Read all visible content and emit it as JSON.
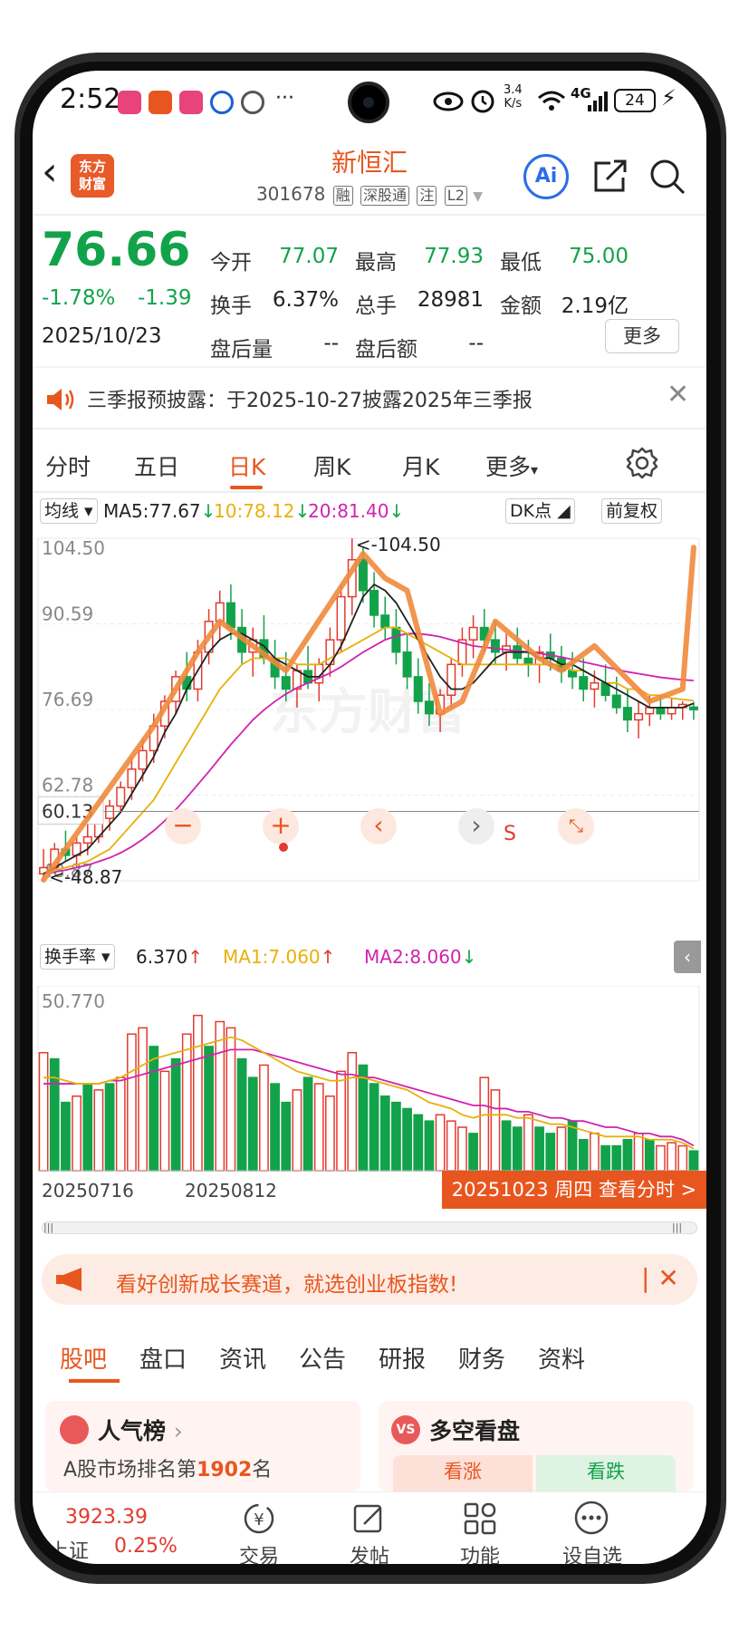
{
  "status_bar": {
    "time": "2:52",
    "dots": "···",
    "net_speed_top": "3.4",
    "net_speed_bottom": "K/s",
    "signal": "4G",
    "battery": "24"
  },
  "header": {
    "logo_line1": "东方",
    "logo_line2": "财富",
    "title": "新恒汇",
    "code": "301678",
    "tags": [
      "融",
      "深股通",
      "注",
      "L2"
    ],
    "ai_label": "Ai"
  },
  "quote": {
    "price": "76.66",
    "change_pct": "-1.78%",
    "change": "-1.39",
    "date": "2025/10/23",
    "rows": [
      [
        {
          "label": "今开",
          "value": "77.07",
          "color": "#12a34a"
        },
        {
          "label": "最高",
          "value": "77.93",
          "color": "#12a34a"
        },
        {
          "label": "最低",
          "value": "75.00",
          "color": "#12a34a"
        }
      ],
      [
        {
          "label": "换手",
          "value": "6.37%",
          "color": "#222222"
        },
        {
          "label": "总手",
          "value": "28981",
          "color": "#222222"
        },
        {
          "label": "金额",
          "value": "2.19亿",
          "color": "#222222"
        }
      ],
      [
        {
          "label": "盘后量",
          "value": "--",
          "color": "#222222"
        },
        {
          "label": "盘后额",
          "value": "--",
          "color": "#222222"
        }
      ]
    ],
    "more_label": "更多"
  },
  "notice": {
    "text": "三季报预披露：于2025-10-27披露2025年三季报"
  },
  "kline_tabs": {
    "items": [
      "分时",
      "五日",
      "日K",
      "周K",
      "月K",
      "更多"
    ],
    "active": 2,
    "more_caret": "▾"
  },
  "ma_row": {
    "selector": "均线",
    "ma5": "MA5:77.67",
    "ma10": "10:78.12",
    "ma20": "20:81.40",
    "dk": "DK点",
    "adjust": "前复权",
    "colors": {
      "ma5": "#222222",
      "ma10": "#e8b00a",
      "ma20": "#d023b0",
      "down": "#12a34a",
      "up": "#e23b2e"
    }
  },
  "chart_data": [
    {
      "type": "candlestick",
      "y_ticks": [
        "104.50",
        "90.59",
        "76.69",
        "62.78",
        "48.87"
      ],
      "ylim": [
        48.87,
        104.5
      ],
      "current_price_label": "60.13",
      "current_price": 60.13,
      "max_label": "<-104.50",
      "min_label": "<-48.87",
      "ohlc": [
        [
          50,
          54,
          49,
          51
        ],
        [
          51,
          55,
          50,
          54
        ],
        [
          54,
          57,
          52,
          53
        ],
        [
          53,
          56,
          51,
          55
        ],
        [
          55,
          58,
          53,
          56
        ],
        [
          56,
          60,
          55,
          59
        ],
        [
          59,
          62,
          57,
          61
        ],
        [
          61,
          65,
          60,
          64
        ],
        [
          64,
          69,
          62,
          67
        ],
        [
          67,
          72,
          65,
          70
        ],
        [
          70,
          76,
          68,
          74
        ],
        [
          74,
          79,
          72,
          78
        ],
        [
          78,
          83,
          76,
          82
        ],
        [
          82,
          86,
          78,
          80
        ],
        [
          80,
          88,
          78,
          86
        ],
        [
          86,
          93,
          84,
          91
        ],
        [
          91,
          96,
          88,
          94
        ],
        [
          94,
          97,
          88,
          90
        ],
        [
          90,
          93,
          84,
          86
        ],
        [
          86,
          90,
          82,
          88
        ],
        [
          88,
          92,
          84,
          85
        ],
        [
          85,
          88,
          80,
          82
        ],
        [
          82,
          86,
          78,
          80
        ],
        [
          80,
          84,
          77,
          83
        ],
        [
          83,
          87,
          80,
          81
        ],
        [
          81,
          85,
          78,
          84
        ],
        [
          84,
          90,
          82,
          88
        ],
        [
          88,
          97,
          86,
          95
        ],
        [
          95,
          104.5,
          92,
          101
        ],
        [
          101,
          103,
          94,
          96
        ],
        [
          96,
          99,
          90,
          92
        ],
        [
          92,
          95,
          88,
          90
        ],
        [
          90,
          93,
          84,
          86
        ],
        [
          86,
          89,
          80,
          82
        ],
        [
          82,
          85,
          76,
          78
        ],
        [
          78,
          81,
          74,
          76
        ],
        [
          76,
          80,
          73,
          79
        ],
        [
          79,
          85,
          77,
          84
        ],
        [
          84,
          90,
          82,
          88
        ],
        [
          88,
          92,
          85,
          90
        ],
        [
          90,
          93,
          86,
          88
        ],
        [
          88,
          91,
          84,
          86
        ],
        [
          86,
          89,
          83,
          87
        ],
        [
          87,
          90,
          84,
          85
        ],
        [
          85,
          88,
          82,
          84
        ],
        [
          84,
          87,
          81,
          86
        ],
        [
          86,
          89,
          83,
          85
        ],
        [
          85,
          87,
          81,
          83
        ],
        [
          83,
          86,
          80,
          82
        ],
        [
          82,
          85,
          78,
          80
        ],
        [
          80,
          83,
          77,
          81
        ],
        [
          81,
          84,
          78,
          79
        ],
        [
          79,
          82,
          76,
          77
        ],
        [
          77,
          80,
          73,
          75
        ],
        [
          75,
          78,
          72,
          76
        ],
        [
          76,
          79,
          74,
          77
        ],
        [
          77,
          79,
          75,
          76
        ],
        [
          76,
          78.5,
          75,
          77
        ],
        [
          77,
          78,
          75,
          77.5
        ],
        [
          77.07,
          77.93,
          75,
          76.66
        ]
      ],
      "ma5": [
        50,
        51,
        52,
        53,
        54,
        56,
        58,
        60,
        63,
        66,
        69,
        73,
        76,
        80,
        83,
        86,
        88,
        89,
        89,
        88,
        87,
        85,
        84,
        83,
        82,
        82,
        84,
        87,
        91,
        95,
        97,
        96,
        94,
        91,
        88,
        85,
        82,
        80,
        80,
        81,
        83,
        85,
        86,
        86,
        86,
        85,
        85,
        84,
        84,
        83,
        82,
        81,
        80,
        79,
        78,
        77,
        77,
        77,
        77,
        77.67
      ],
      "ma10": [
        50,
        50.5,
        51,
        51.5,
        52,
        53,
        54,
        56,
        58,
        60,
        62,
        65,
        68,
        71,
        74,
        77,
        80,
        82,
        84,
        85,
        85,
        85,
        85,
        84,
        84,
        84,
        85,
        86,
        87,
        88,
        89,
        90,
        90,
        89,
        88,
        87,
        86,
        85,
        84,
        84,
        84,
        84,
        84,
        84,
        84,
        84,
        84,
        84,
        83,
        83,
        82,
        81,
        81,
        80,
        80,
        79,
        79,
        78.5,
        78.3,
        78.12
      ],
      "ma20": [
        50,
        50.3,
        50.6,
        51,
        51.4,
        52,
        52.6,
        53.4,
        54.4,
        55.6,
        57,
        58.6,
        60.4,
        62.4,
        64.5,
        66.6,
        68.8,
        71,
        73,
        75,
        76.6,
        78,
        79.2,
        80.2,
        81,
        81.8,
        82.6,
        83.6,
        84.8,
        86,
        87,
        88,
        88.6,
        89,
        89,
        88.8,
        88.5,
        88,
        87.5,
        87,
        86.8,
        86.6,
        86.4,
        86.2,
        86,
        85.8,
        85.5,
        85.2,
        84.8,
        84.4,
        84,
        83.6,
        83.2,
        82.8,
        82.5,
        82.2,
        81.9,
        81.7,
        81.5,
        81.4
      ]
    },
    {
      "type": "bar",
      "title": "换手率",
      "values_label": "6.370",
      "ma1_label": "MA1:7.060",
      "ma2_label": "MA2:8.060",
      "y_top_label": "50.770",
      "ylim": [
        0,
        50.77
      ],
      "values": [
        38,
        36,
        22,
        24,
        28,
        26,
        28,
        30,
        44,
        46,
        40,
        32,
        36,
        44,
        50,
        40,
        48,
        46,
        36,
        30,
        34,
        28,
        22,
        26,
        30,
        28,
        24,
        32,
        38,
        34,
        28,
        24,
        22,
        20,
        18,
        16,
        18,
        16,
        14,
        12,
        30,
        26,
        16,
        14,
        18,
        14,
        12,
        14,
        16,
        10,
        12,
        8,
        8,
        10,
        12,
        10,
        8,
        9,
        8,
        6.37
      ],
      "up": [
        1,
        0,
        0,
        1,
        0,
        1,
        0,
        1,
        1,
        1,
        0,
        1,
        0,
        1,
        1,
        0,
        1,
        1,
        0,
        0,
        1,
        0,
        0,
        1,
        0,
        1,
        1,
        1,
        1,
        0,
        0,
        0,
        0,
        0,
        0,
        0,
        1,
        1,
        1,
        0,
        1,
        1,
        0,
        0,
        1,
        0,
        0,
        1,
        0,
        0,
        1,
        0,
        0,
        0,
        1,
        0,
        1,
        1,
        1,
        0
      ],
      "ma1": [
        30,
        30,
        29,
        28,
        28,
        28,
        29,
        30,
        32,
        34,
        36,
        37,
        38,
        39,
        40,
        41,
        42,
        43,
        42,
        40,
        38,
        36,
        34,
        32,
        31,
        30,
        29,
        29,
        30,
        30,
        29,
        28,
        27,
        26,
        24,
        22,
        21,
        20,
        18,
        17,
        18,
        18,
        18,
        17,
        17,
        16,
        15,
        15,
        14,
        13,
        12,
        11,
        11,
        11,
        11,
        10,
        10,
        10,
        9,
        7.06
      ],
      "ma2": [
        28,
        28,
        28,
        28,
        28,
        28,
        29,
        29,
        30,
        31,
        32,
        33,
        34,
        35,
        36,
        37,
        38,
        39,
        39,
        39,
        38,
        37,
        36,
        35,
        34,
        33,
        32,
        31,
        31,
        30,
        30,
        29,
        28,
        27,
        26,
        25,
        24,
        23,
        22,
        21,
        21,
        20,
        20,
        19,
        19,
        18,
        17,
        17,
        16,
        16,
        15,
        14,
        14,
        13,
        12,
        12,
        11,
        11,
        10,
        8.06
      ]
    }
  ],
  "x_dates": [
    "20250716",
    "20250812"
  ],
  "date_button": "20251023 周四 查看分时 >",
  "chart_controls": [
    "−",
    "+",
    "‹",
    "›",
    "S"
  ],
  "promo": {
    "text": "看好创新成长赛道，就选创业板指数!"
  },
  "bottom_tabs": {
    "items": [
      "股吧",
      "盘口",
      "资讯",
      "公告",
      "研报",
      "财务",
      "资料"
    ],
    "active": 0
  },
  "cards": {
    "left_title": "人气榜",
    "left_sub_prefix": "A股市场排名第",
    "left_rank": "1902",
    "left_sub_suffix": "名",
    "right_title": "多空看盘",
    "right_bull": "看涨",
    "right_bear": "看跌"
  },
  "nav": {
    "index_value": "3923.39",
    "index_name": "上证",
    "index_pct": "0.25%",
    "items": [
      "交易",
      "发帖",
      "功能",
      "设自选"
    ]
  }
}
